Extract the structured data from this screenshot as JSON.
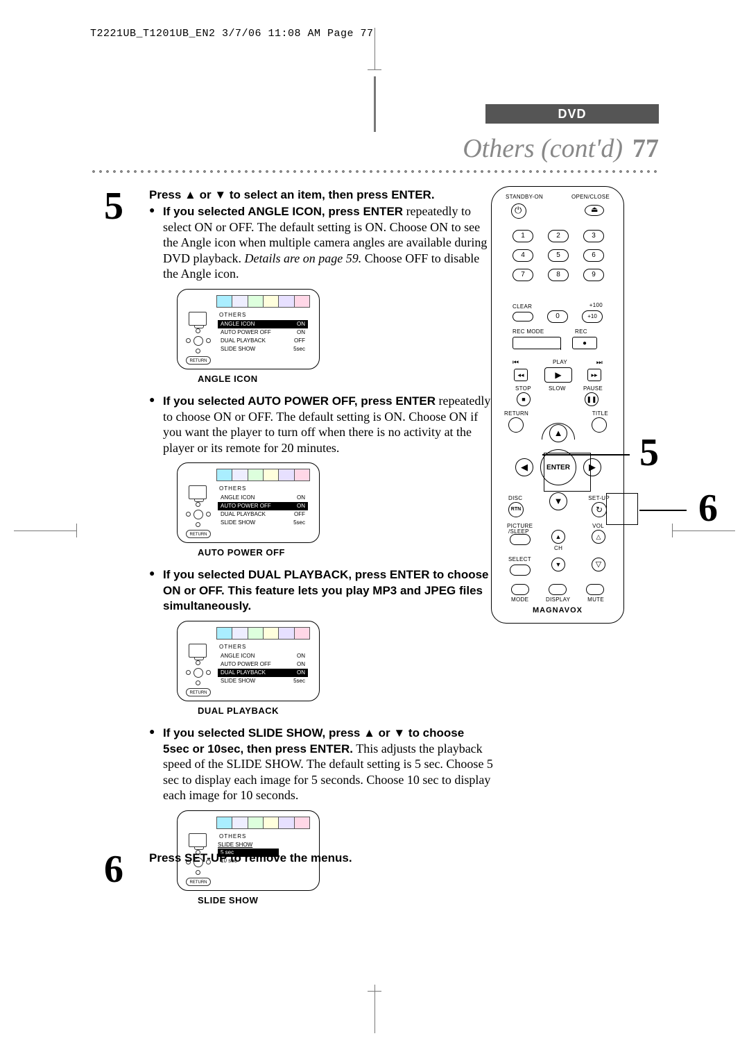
{
  "print_header": "T2221UB_T1201UB_EN2  3/7/06  11:08 AM  Page 77",
  "dvd_label": "DVD",
  "banner_title": "Others (cont'd)",
  "banner_page": "77",
  "step5": {
    "num": "5",
    "lead": "Press ▲ or ▼ to select an item, then press ENTER.",
    "angle": {
      "head": "If you selected ANGLE ICON, press ENTER",
      "body1": "repeatedly to select ON or OFF.  The default setting is ON. Choose ON to see the Angle icon when multiple camera angles are available during DVD playback. ",
      "body_ital": "Details are on page 59.",
      "body2": " Choose OFF to disable the Angle icon.",
      "caption": "ANGLE ICON",
      "menu": {
        "title": "OTHERS",
        "rows": [
          {
            "k": "ANGLE ICON",
            "v": "ON",
            "sel": true
          },
          {
            "k": "AUTO POWER OFF",
            "v": "ON",
            "sel": false
          },
          {
            "k": "DUAL PLAYBACK",
            "v": "OFF",
            "sel": false
          },
          {
            "k": "SLIDE SHOW",
            "v": "5sec",
            "sel": false
          }
        ]
      }
    },
    "auto": {
      "head": "If you selected AUTO POWER OFF, press ENTER",
      "body": "repeatedly to choose ON or OFF. The default setting is ON. Choose ON if you want the player to turn off when there is no activity at the player or its remote for 20 minutes.",
      "caption": "AUTO POWER OFF",
      "menu": {
        "title": "OTHERS",
        "rows": [
          {
            "k": "ANGLE ICON",
            "v": "ON",
            "sel": false
          },
          {
            "k": "AUTO POWER OFF",
            "v": "ON",
            "sel": true
          },
          {
            "k": "DUAL PLAYBACK",
            "v": "OFF",
            "sel": false
          },
          {
            "k": "SLIDE SHOW",
            "v": "5sec",
            "sel": false
          }
        ]
      }
    },
    "dual": {
      "head": "If you selected DUAL PLAYBACK, press ENTER to choose ON or OFF.  This feature lets you play MP3 and JPEG files simultaneously.",
      "caption": "DUAL PLAYBACK",
      "menu": {
        "title": "OTHERS",
        "rows": [
          {
            "k": "ANGLE ICON",
            "v": "ON",
            "sel": false
          },
          {
            "k": "AUTO POWER OFF",
            "v": "ON",
            "sel": false
          },
          {
            "k": "DUAL PLAYBACK",
            "v": "ON",
            "sel": true
          },
          {
            "k": "SLIDE SHOW",
            "v": "5sec",
            "sel": false
          }
        ]
      }
    },
    "slide": {
      "head_a": "If you selected SLIDE SHOW, press ▲ or ▼ to choose 5sec or 10sec, then press ENTER.",
      "body": " This adjusts the playback speed of the SLIDE SHOW. The default setting is 5 sec. Choose 5 sec to display each image for 5 seconds. Choose 10 sec to display each image for 10 seconds.",
      "caption": "SLIDE SHOW",
      "menu": {
        "title": "OTHERS",
        "head": "SLIDE SHOW",
        "rows": [
          {
            "k": "5 sec",
            "sel": true
          },
          {
            "k": "10 sec",
            "sel": false
          }
        ]
      }
    }
  },
  "step6": {
    "num": "6",
    "text": "Press SET-UP to remove the menus."
  },
  "remote": {
    "standby": "STANDBY-ON",
    "openclose": "OPEN/CLOSE",
    "numbers": [
      "1",
      "2",
      "3",
      "4",
      "5",
      "6",
      "7",
      "8",
      "9"
    ],
    "clear": "CLEAR",
    "zero": "0",
    "plus100": "+100",
    "plus10": "+10",
    "recmode": "REC MODE",
    "rec": "REC",
    "play": "PLAY",
    "stop": "STOP",
    "slow": "SLOW",
    "pause": "PAUSE",
    "return": "RETURN",
    "title": "TITLE",
    "enter": "ENTER",
    "disc": "DISC",
    "setup": "SET-UP",
    "picsleep1": "PICTURE",
    "picsleep2": "/SLEEP",
    "ch": "CH",
    "vol": "VOL",
    "select": "SELECT",
    "mode": "MODE",
    "display": "DISPLAY",
    "mute": "MUTE",
    "brand": "MAGNAVOX"
  },
  "callouts": {
    "c5": "5",
    "c6": "6"
  },
  "return_label": "RETURN"
}
